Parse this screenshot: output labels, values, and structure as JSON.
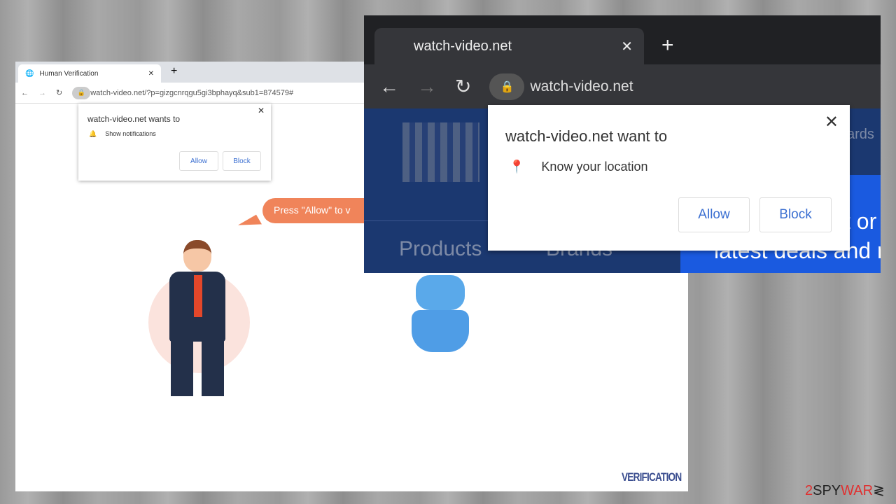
{
  "back_window": {
    "tab_title": "Human Verification",
    "url": "watch-video.net/?p=gizgcnrqgu5gi3bphayq&sub1=874579#",
    "popup": {
      "title": "watch-video.net wants to",
      "permission": "Show notifications",
      "allow": "Allow",
      "block": "Block"
    },
    "bubble_text": "Press \"Allow\" to v",
    "footer_logo": "VERIFICATION"
  },
  "front_window": {
    "tab_title": "watch-video.net",
    "url": "watch-video.net",
    "popup": {
      "title": "watch-video.net want to",
      "permission": "Know your location",
      "allow": "Allow",
      "block": "Block"
    },
    "nav": [
      "Products",
      "Brands",
      "ards"
    ],
    "banner": [
      "t or",
      "latest deals and r"
    ]
  },
  "watermark": {
    "prefix": "2",
    "mid": "SPY",
    "suffix": "WAR"
  },
  "colors": {
    "accent": "#3b6fd1",
    "bubble": "#f0845a",
    "banner": "#1a5ae0"
  }
}
